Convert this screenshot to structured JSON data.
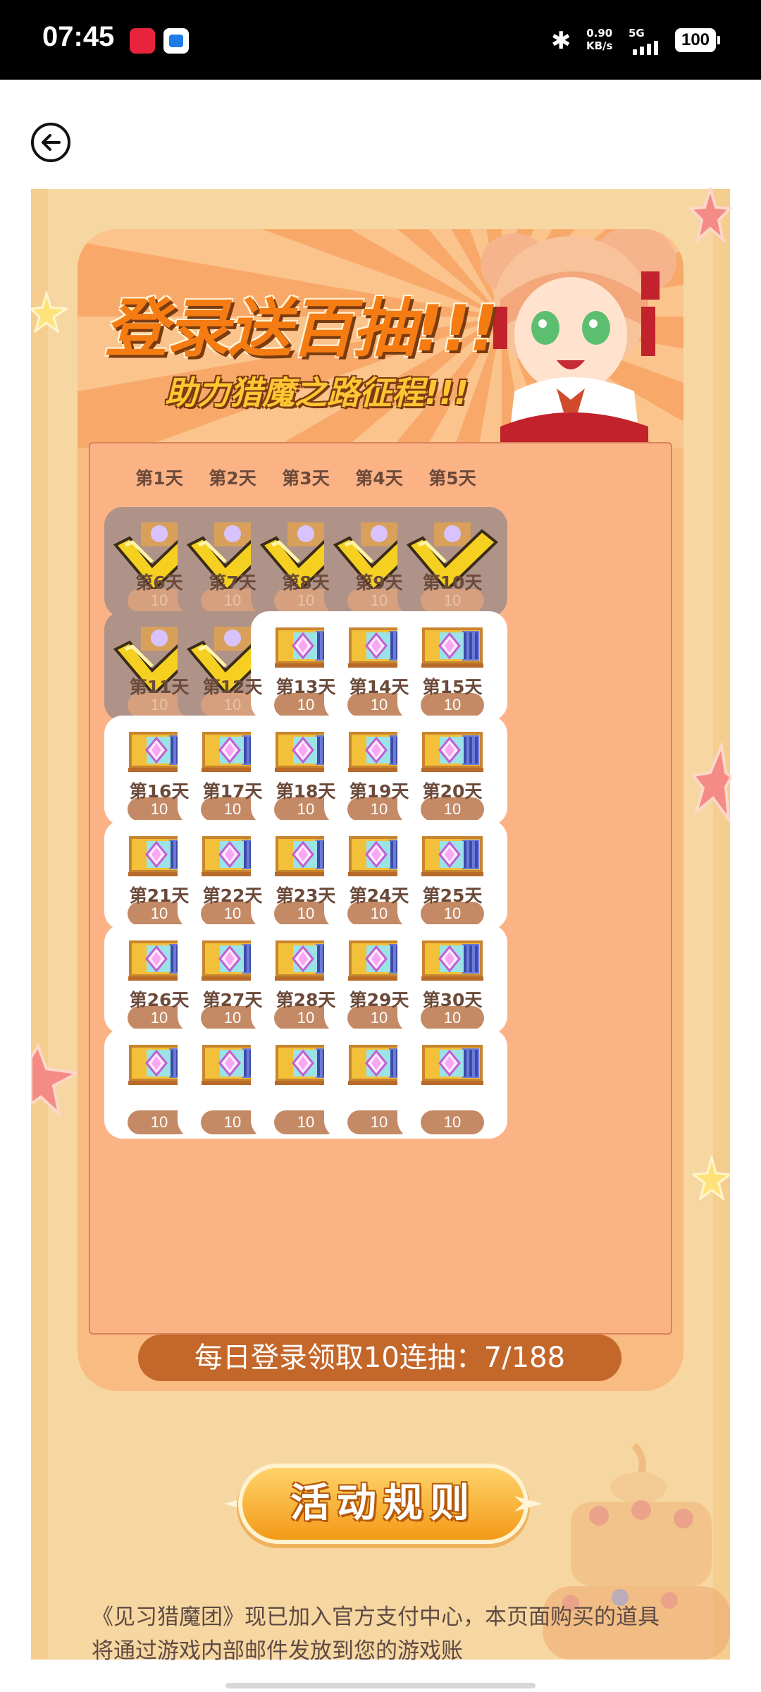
{
  "status_bar": {
    "time": "07:45",
    "net_speed_value": "0.90",
    "net_speed_unit": "KB/s",
    "network": "5G",
    "battery": "100"
  },
  "header": {
    "back_icon": "back-arrow-icon"
  },
  "banner": {
    "title": "登录送百抽!!!",
    "subtitle": "助力猎魔之路征程!!!"
  },
  "days": [
    {
      "label": "第1天",
      "qty": "10",
      "claimed": true
    },
    {
      "label": "第2天",
      "qty": "10",
      "claimed": true
    },
    {
      "label": "第3天",
      "qty": "10",
      "claimed": true
    },
    {
      "label": "第4天",
      "qty": "10",
      "claimed": true
    },
    {
      "label": "第5天",
      "qty": "10",
      "claimed": true
    },
    {
      "label": "第6天",
      "qty": "10",
      "claimed": true
    },
    {
      "label": "第7天",
      "qty": "10",
      "claimed": true
    },
    {
      "label": "第8天",
      "qty": "10",
      "claimed": false
    },
    {
      "label": "第9天",
      "qty": "10",
      "claimed": false
    },
    {
      "label": "第10天",
      "qty": "10",
      "claimed": false
    },
    {
      "label": "第11天",
      "qty": "10",
      "claimed": false
    },
    {
      "label": "第12天",
      "qty": "10",
      "claimed": false
    },
    {
      "label": "第13天",
      "qty": "10",
      "claimed": false
    },
    {
      "label": "第14天",
      "qty": "10",
      "claimed": false
    },
    {
      "label": "第15天",
      "qty": "10",
      "claimed": false
    },
    {
      "label": "第16天",
      "qty": "10",
      "claimed": false
    },
    {
      "label": "第17天",
      "qty": "10",
      "claimed": false
    },
    {
      "label": "第18天",
      "qty": "10",
      "claimed": false
    },
    {
      "label": "第19天",
      "qty": "10",
      "claimed": false
    },
    {
      "label": "第20天",
      "qty": "10",
      "claimed": false
    },
    {
      "label": "第21天",
      "qty": "10",
      "claimed": false
    },
    {
      "label": "第22天",
      "qty": "10",
      "claimed": false
    },
    {
      "label": "第23天",
      "qty": "10",
      "claimed": false
    },
    {
      "label": "第24天",
      "qty": "10",
      "claimed": false
    },
    {
      "label": "第25天",
      "qty": "10",
      "claimed": false
    },
    {
      "label": "第26天",
      "qty": "10",
      "claimed": false
    },
    {
      "label": "第27天",
      "qty": "10",
      "claimed": false
    },
    {
      "label": "第28天",
      "qty": "10",
      "claimed": false
    },
    {
      "label": "第29天",
      "qty": "10",
      "claimed": false
    },
    {
      "label": "第30天",
      "qty": "10",
      "claimed": false
    }
  ],
  "progress": {
    "text": "每日登录领取10连抽：7/188"
  },
  "rules_button": {
    "label": "活动规则"
  },
  "rules_text": "《见习猎魔团》现已加入官方支付中心，本页面购买的道具将通过游戏内部邮件发放到您的游戏账",
  "colors": {
    "page_bg": "#f7d7a1",
    "accent_orange": "#f57c13",
    "progress_bg": "#c4672a",
    "claimed_box": "#b09388"
  }
}
